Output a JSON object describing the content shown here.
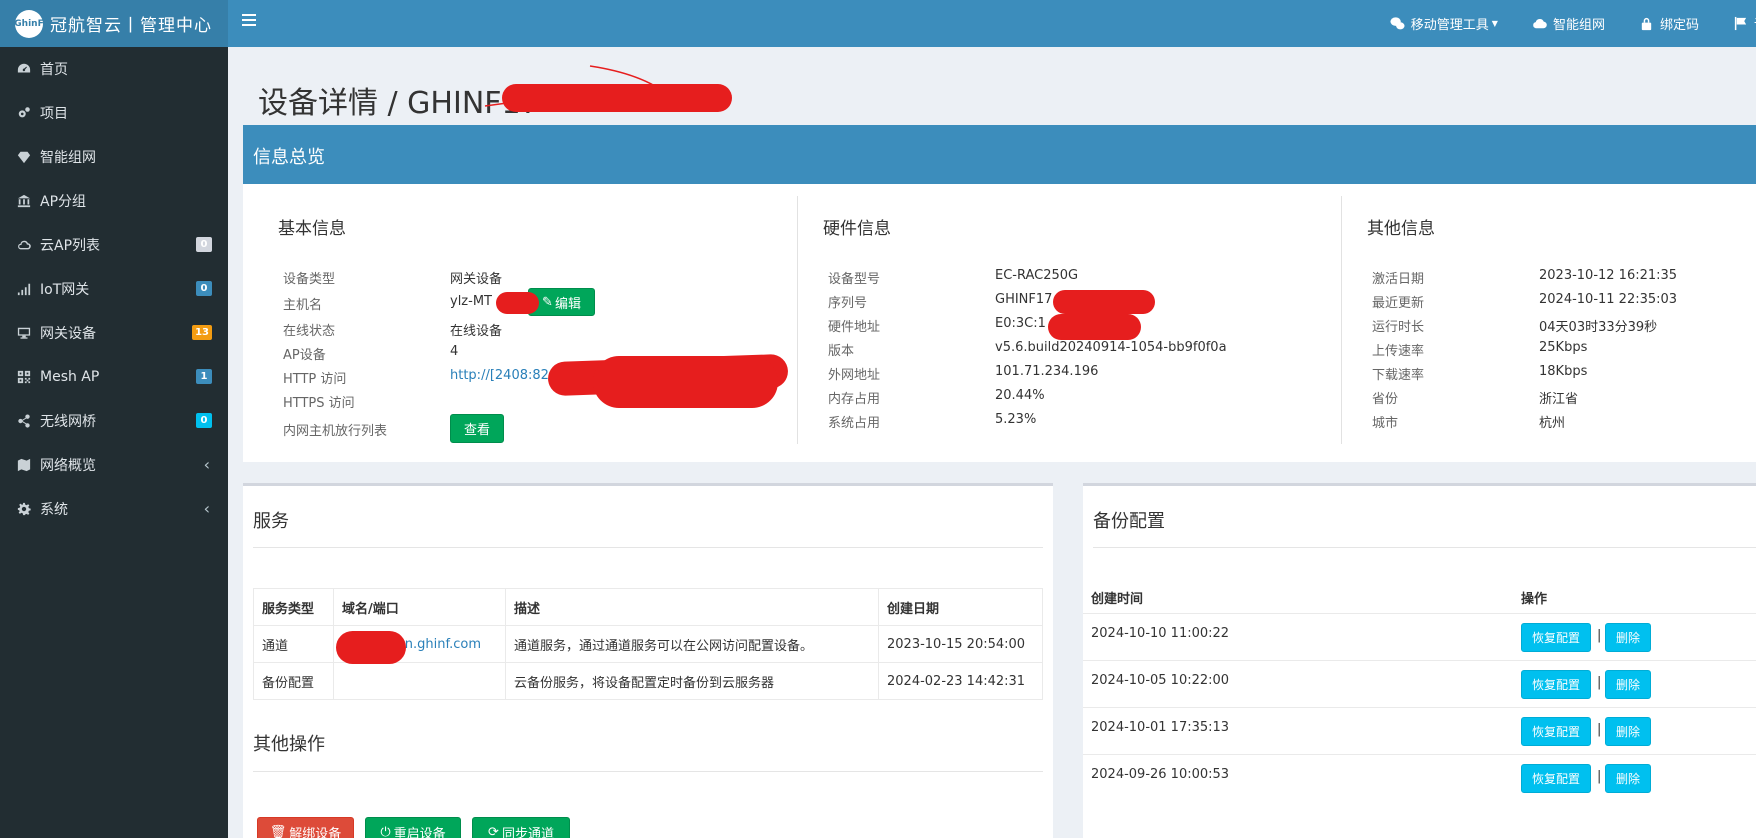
{
  "brand": {
    "logo_badge": "GhinF",
    "title": "冠航智云丨管理中心"
  },
  "sidebar": {
    "items": [
      {
        "label": "首页",
        "icon": "dashboard-icon"
      },
      {
        "label": "项目",
        "icon": "cogs-icon"
      },
      {
        "label": "智能组网",
        "icon": "diamond-icon"
      },
      {
        "label": "AP分组",
        "icon": "bank-icon"
      },
      {
        "label": "云AP列表",
        "icon": "cloud-icon",
        "badge": "0",
        "badge_color": "#d2d6de"
      },
      {
        "label": "IoT网关",
        "icon": "signal-icon",
        "badge": "0",
        "badge_color": "#3c8dbc"
      },
      {
        "label": "网关设备",
        "icon": "desktop-icon",
        "badge": "13",
        "badge_color": "#f39c12"
      },
      {
        "label": "Mesh AP",
        "icon": "qrcode-icon",
        "badge": "1",
        "badge_color": "#3c8dbc"
      },
      {
        "label": "无线网桥",
        "icon": "share-icon",
        "badge": "0",
        "badge_color": "#00c0ef"
      },
      {
        "label": "网络概览",
        "icon": "map-icon",
        "chevron": "‹"
      },
      {
        "label": "系统",
        "icon": "gear-icon",
        "chevron": "‹"
      }
    ]
  },
  "topbar": {
    "mobile_tools": "移动管理工具",
    "smart_network": "智能组网",
    "bind_code": "绑定码",
    "language": "语言"
  },
  "page": {
    "title": "设备详情 / GHINF17"
  },
  "overview": {
    "header": "信息总览",
    "basic": {
      "title": "基本信息",
      "device_type_label": "设备类型",
      "device_type": "网关设备",
      "hostname_label": "主机名",
      "hostname": "ylz-MT",
      "edit_button": "编辑",
      "online_label": "在线状态",
      "online": "在线设备",
      "ap_label": "AP设备",
      "ap": "4",
      "http_label": "HTTP 访问",
      "http": "http://[2408:824",
      "https_label": "HTTPS 访问",
      "whitelist_label": "内网主机放行列表",
      "view_button": "查看"
    },
    "hardware": {
      "title": "硬件信息",
      "model_label": "设备型号",
      "model": "EC-RAC250G",
      "serial_label": "序列号",
      "serial": "GHINF17",
      "mac_label": "硬件地址",
      "mac": "E0:3C:1",
      "version_label": "版本",
      "version": "v5.6.build20240914-1054-bb9f0f0a",
      "wan_label": "外网地址",
      "wan": "101.71.234.196",
      "mem_label": "内存占用",
      "mem": "20.44%",
      "sys_label": "系统占用",
      "sys": "5.23%"
    },
    "other": {
      "title": "其他信息",
      "activated_label": "激活日期",
      "activated": "2023-10-12 16:21:35",
      "updated_label": "最近更新",
      "updated": "2024-10-11 22:35:03",
      "uptime_label": "运行时长",
      "uptime": "04天03时33分39秒",
      "up_label": "上传速率",
      "up": "25Kbps",
      "down_label": "下载速率",
      "down": "18Kbps",
      "province_label": "省份",
      "province": "浙江省",
      "city_label": "城市",
      "city": "杭州"
    }
  },
  "services": {
    "title": "服务",
    "columns": [
      "服务类型",
      "域名/端口",
      "描述",
      "创建日期"
    ],
    "rows": [
      {
        "type": "通道",
        "domain": "n.ghinf.com",
        "desc": "通道服务，通过通道服务可以在公网访问配置设备。",
        "date": "2023-10-15 20:54:00"
      },
      {
        "type": "备份配置",
        "domain": "",
        "desc": "云备份服务，将设备配置定时备份到云服务器",
        "date": "2024-02-23 14:42:31"
      }
    ]
  },
  "other_ops": {
    "title": "其他操作",
    "unbind": "解绑设备",
    "reboot": "重启设备",
    "sync": "同步通道"
  },
  "backup": {
    "title": "备份配置",
    "col_time": "创建时间",
    "col_action": "操作",
    "restore_label": "恢复配置",
    "delete_label": "删除",
    "separator": "|",
    "rows": [
      "2024-10-10 11:00:22",
      "2024-10-05 10:22:00",
      "2024-10-01 17:35:13",
      "2024-09-26 10:00:53"
    ]
  },
  "colors": {
    "topbar": "#3c8dbc",
    "sidebar": "#222d32",
    "primary": "#3c8dbc",
    "success": "#00a65a",
    "danger": "#dd4b39",
    "info": "#00c0ef",
    "redaction": "#e61e1e"
  }
}
